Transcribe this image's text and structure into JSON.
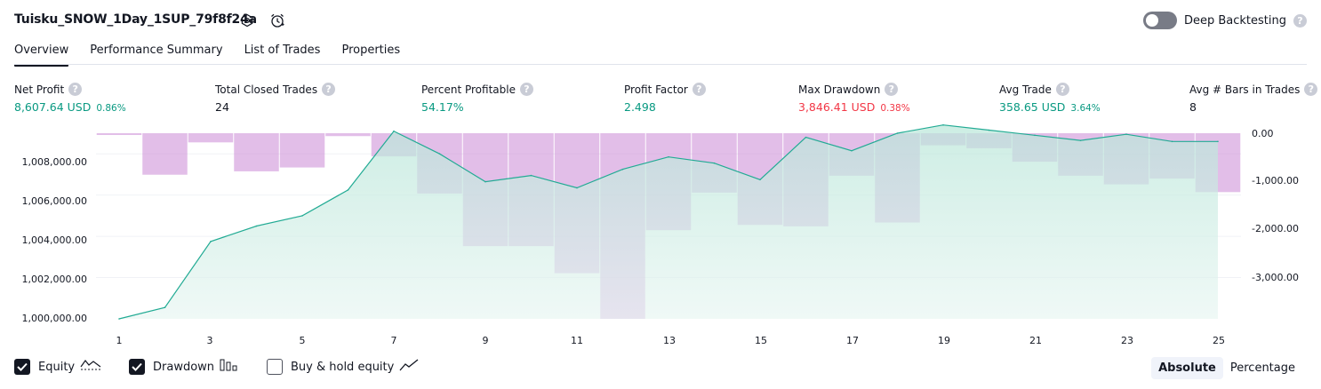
{
  "header": {
    "strategy_title": "Tuisku_SNOW_1Day_1SUP_79f8f24a",
    "deep_backtesting_label": "Deep Backtesting",
    "help_glyph": "?"
  },
  "tabs": [
    {
      "label": "Overview",
      "active": true
    },
    {
      "label": "Performance Summary",
      "active": false
    },
    {
      "label": "List of Trades",
      "active": false
    },
    {
      "label": "Properties",
      "active": false
    }
  ],
  "stats": [
    {
      "label": "Net Profit",
      "value": "8,607.64 USD",
      "pct": "0.86%",
      "color": "green"
    },
    {
      "label": "Total Closed Trades",
      "value": "24",
      "pct": "",
      "color": "dark"
    },
    {
      "label": "Percent Profitable",
      "value": "54.17%",
      "pct": "",
      "color": "green"
    },
    {
      "label": "Profit Factor",
      "value": "2.498",
      "pct": "",
      "color": "green"
    },
    {
      "label": "Max Drawdown",
      "value": "3,846.41 USD",
      "pct": "0.38%",
      "color": "red"
    },
    {
      "label": "Avg Trade",
      "value": "358.65 USD",
      "pct": "3.64%",
      "color": "green"
    },
    {
      "label": "Avg # Bars in Trades",
      "value": "8",
      "pct": "",
      "color": "dark"
    }
  ],
  "chart_data": {
    "type": "area",
    "x": [
      1,
      2,
      3,
      4,
      5,
      6,
      7,
      8,
      9,
      10,
      11,
      12,
      13,
      14,
      15,
      16,
      17,
      18,
      19,
      20,
      21,
      22,
      23,
      24,
      25
    ],
    "x_tick_labels": [
      "1",
      "3",
      "5",
      "7",
      "9",
      "11",
      "13",
      "15",
      "17",
      "19",
      "21",
      "23",
      "25"
    ],
    "left_axis": {
      "tick_labels": [
        "1,008,000.00",
        "1,006,000.00",
        "1,004,000.00",
        "1,002,000.00",
        "1,000,000.00"
      ],
      "ylim": [
        1000000,
        1009000
      ]
    },
    "right_axis": {
      "tick_labels": [
        "0.00",
        "-1,000.00",
        "-2,000.00",
        "-3,000.00"
      ],
      "ylim": [
        -3846.41,
        0
      ]
    },
    "series": [
      {
        "name": "Equity",
        "axis": "left",
        "color": "#22ab94",
        "values": [
          1000000,
          1000550,
          1003750,
          1004500,
          1005000,
          1006250,
          1009100,
          1008000,
          1006650,
          1006950,
          1006350,
          1007250,
          1007850,
          1007550,
          1006750,
          1008800,
          1008150,
          1009000,
          1009400,
          1009150,
          1008900,
          1008650,
          1008950,
          1008600,
          1008600
        ]
      },
      {
        "name": "Drawdown",
        "axis": "right",
        "color": "#ce93d8",
        "values": [
          0,
          -860,
          -190,
          -790,
          -710,
          -60,
          -480,
          -1250,
          -2340,
          -2340,
          -2900,
          -3846.41,
          -2010,
          -1230,
          -1900,
          -1930,
          -880,
          -1850,
          -250,
          -310,
          -590,
          -880,
          -1060,
          -940,
          -1220
        ]
      }
    ],
    "grid": true
  },
  "footer": {
    "equity_label": "Equity",
    "drawdown_label": "Drawdown",
    "buy_hold_label": "Buy & hold equity",
    "equity_checked": true,
    "drawdown_checked": true,
    "buy_hold_checked": false,
    "absolute_label": "Absolute",
    "percentage_label": "Percentage",
    "active_mode": "Absolute"
  }
}
